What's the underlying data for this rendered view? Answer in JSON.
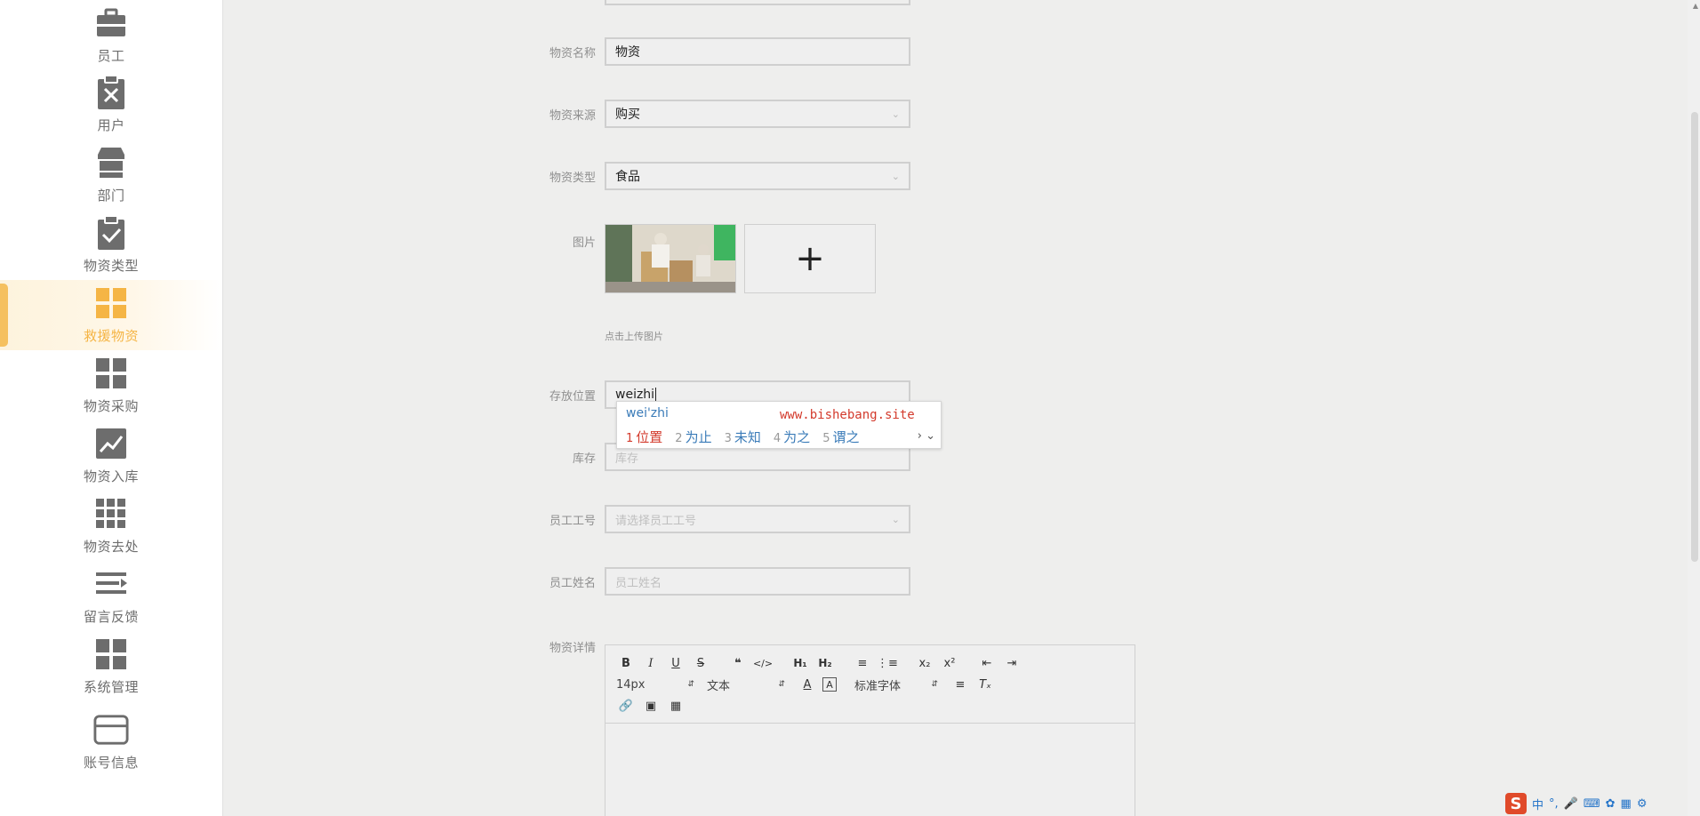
{
  "sidebar": {
    "items": [
      {
        "label": "员工",
        "icon": "briefcase-icon"
      },
      {
        "label": "用户",
        "icon": "clipboard-x-icon"
      },
      {
        "label": "部门",
        "icon": "store-icon"
      },
      {
        "label": "物资类型",
        "icon": "clipboard-check-icon"
      },
      {
        "label": "救援物资",
        "icon": "grid-icon"
      },
      {
        "label": "物资采购",
        "icon": "grid-icon"
      },
      {
        "label": "物资入库",
        "icon": "chart-up-icon"
      },
      {
        "label": "物资去处",
        "icon": "apps-icon"
      },
      {
        "label": "留言反馈",
        "icon": "list-icon"
      },
      {
        "label": "系统管理",
        "icon": "grid-icon"
      },
      {
        "label": "账号信息",
        "icon": "card-icon"
      }
    ],
    "active_index": 4,
    "active_color": "#f5b545"
  },
  "form": {
    "name": {
      "label": "物资名称",
      "value": "物资"
    },
    "source": {
      "label": "物资来源",
      "value": "购买"
    },
    "type": {
      "label": "物资类型",
      "value": "食品"
    },
    "image": {
      "label": "图片",
      "tip": "点击上传图片",
      "add_symbol": "+"
    },
    "location": {
      "label": "存放位置",
      "value": "weizhi"
    },
    "stock": {
      "label": "库存",
      "placeholder": "库存"
    },
    "employee_no": {
      "label": "员工工号",
      "placeholder": "请选择员工工号"
    },
    "employee_name": {
      "label": "员工姓名",
      "placeholder": "员工姓名"
    },
    "detail": {
      "label": "物资详情"
    }
  },
  "ime": {
    "composition": "wei'zhi",
    "site": "www.bishebang.site",
    "candidates": [
      {
        "num": "1",
        "text": "位置"
      },
      {
        "num": "2",
        "text": "为止"
      },
      {
        "num": "3",
        "text": "未知"
      },
      {
        "num": "4",
        "text": "为之"
      },
      {
        "num": "5",
        "text": "谓之"
      }
    ]
  },
  "editor": {
    "font_size": "14px",
    "format": "文本",
    "font_family": "标准字体"
  },
  "tray": {
    "logo": "S",
    "lang": "中"
  }
}
